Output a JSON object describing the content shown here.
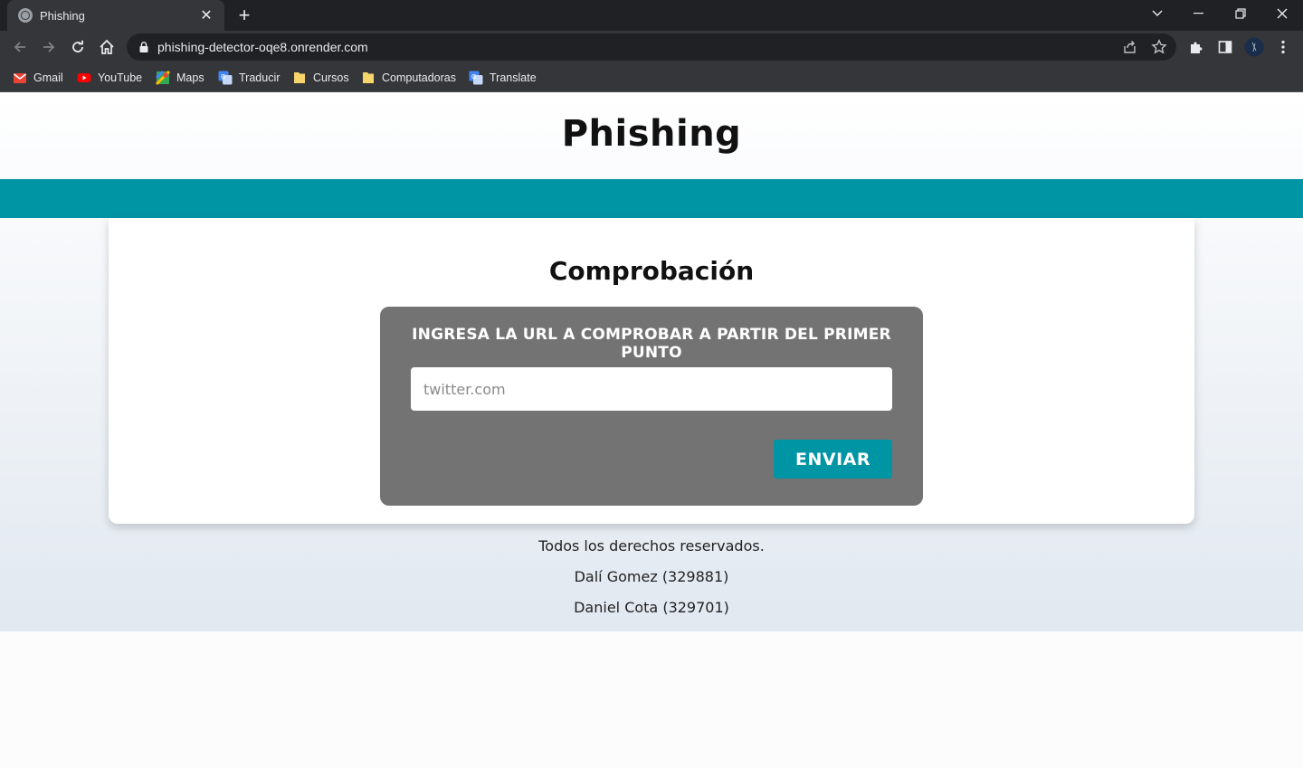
{
  "browser": {
    "tab_title": "Phishing",
    "url": "phishing-detector-oqe8.onrender.com",
    "bookmarks": [
      {
        "label": "Gmail",
        "icon": "gmail-icon"
      },
      {
        "label": "YouTube",
        "icon": "youtube-icon"
      },
      {
        "label": "Maps",
        "icon": "maps-icon"
      },
      {
        "label": "Traducir",
        "icon": "translate-icon"
      },
      {
        "label": "Cursos",
        "icon": "folder-icon"
      },
      {
        "label": "Computadoras",
        "icon": "folder-icon"
      },
      {
        "label": "Translate",
        "icon": "translate-icon"
      }
    ]
  },
  "page": {
    "title": "Phishing",
    "accent_color": "#0095a5",
    "card": {
      "title": "Comprobación",
      "form_label": "INGRESA LA URL A COMPROBAR A PARTIR DEL PRIMER PUNTO",
      "input_placeholder": "twitter.com",
      "input_value": "",
      "submit_label": "ENVIAR"
    },
    "footer": {
      "rights": "Todos los derechos reservados.",
      "author_1": "Dalí Gomez (329881)",
      "author_2": "Daniel Cota (329701)"
    }
  }
}
